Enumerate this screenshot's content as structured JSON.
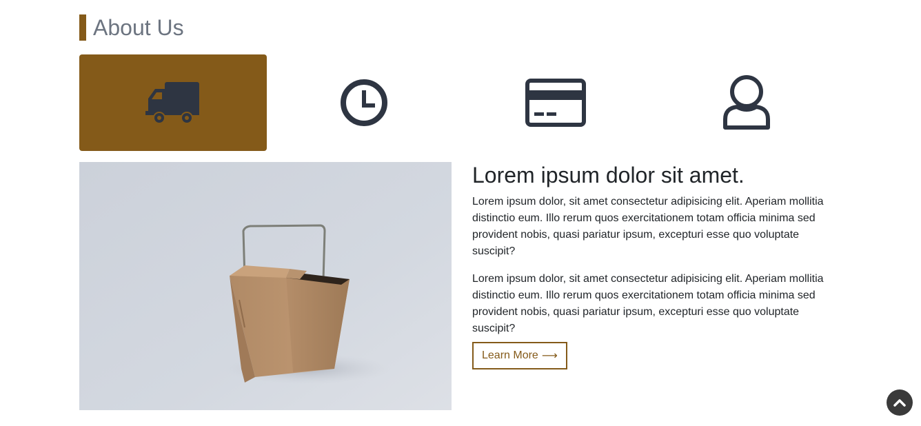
{
  "section": {
    "title": "About Us"
  },
  "tabs": [
    {
      "icon": "truck-icon",
      "active": true
    },
    {
      "icon": "clock-icon",
      "active": false
    },
    {
      "icon": "credit-card-icon",
      "active": false
    },
    {
      "icon": "user-icon",
      "active": false
    }
  ],
  "content": {
    "heading": "Lorem ipsum dolor sit amet.",
    "paragraphs": [
      "Lorem ipsum dolor, sit amet consectetur adipisicing elit. Aperiam mollitia distinctio eum. Illo rerum quos exercitationem totam officia minima sed provident nobis, quasi pariatur ipsum, excepturi esse quo voluptate suscipit?",
      "Lorem ipsum dolor, sit amet consectetur adipisicing elit. Aperiam mollitia distinctio eum. Illo rerum quos exercitationem totam officia minima sed provident nobis, quasi pariatur ipsum, excepturi esse quo voluptate suscipit?"
    ],
    "button_label": "Learn More",
    "button_arrow": "⟶"
  },
  "colors": {
    "accent": "#845a19",
    "icon": "#2e3542",
    "title_text": "#6c7480",
    "body_text": "#212529"
  },
  "icons": {
    "scroll_top": "chevron-up-icon"
  }
}
